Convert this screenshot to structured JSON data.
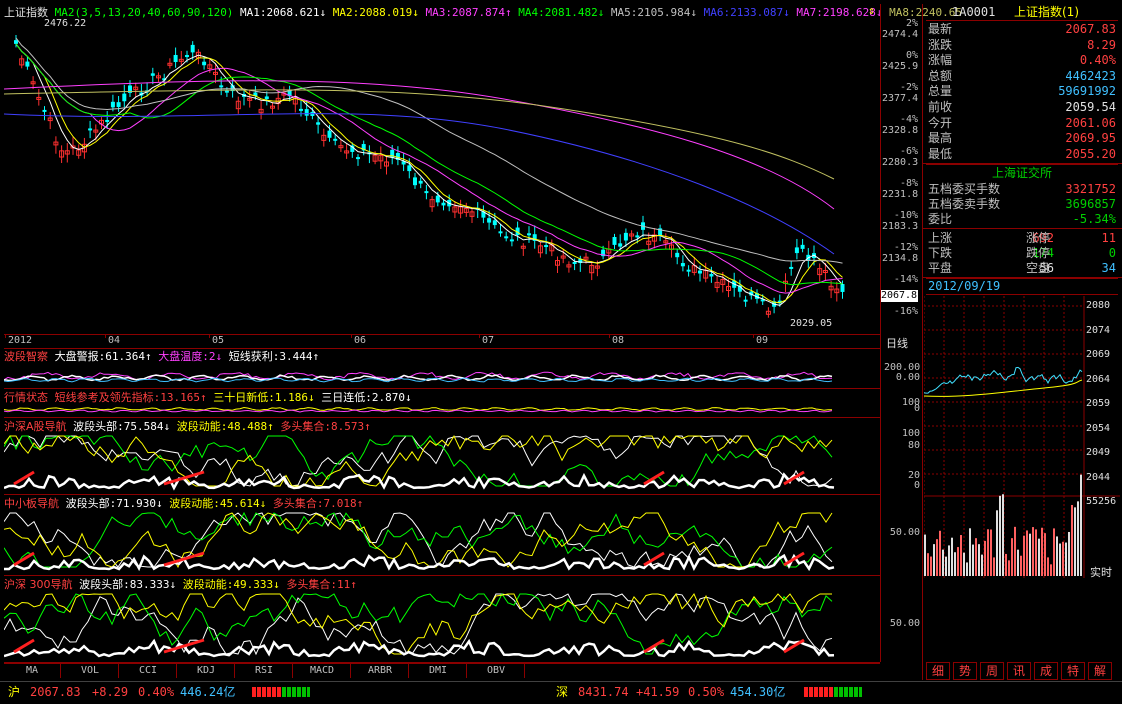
{
  "main": {
    "title": "上证指数",
    "ma_legend": [
      {
        "text": "MA2(3,5,13,20,40,60,90,120)",
        "color": "#00ff00"
      },
      {
        "text": "MA1:2068.621↓",
        "color": "#ffffff"
      },
      {
        "text": "MA2:2088.019↓",
        "color": "#ffff00"
      },
      {
        "text": "MA3:2087.874↑",
        "color": "#ff40ff"
      },
      {
        "text": "MA4:2081.482↓",
        "color": "#00ff00"
      },
      {
        "text": "MA5:2105.984↓",
        "color": "#c0c0c0"
      },
      {
        "text": "MA6:2133.087↓",
        "color": "#4040ff"
      },
      {
        "text": "MA7:2198.628↓",
        "color": "#ff40ff"
      },
      {
        "text": "MA8:2240.65",
        "color": "#c0c060"
      }
    ],
    "high_label": "2476.22",
    "low_label": "2029.05",
    "current_price_tag": "2067.8",
    "y_axis": [
      {
        "price": "2474.4",
        "pct": "2%"
      },
      {
        "price": "2425.9",
        "pct": "0%"
      },
      {
        "price": "2377.4",
        "pct": "-2%"
      },
      {
        "price": "2328.8",
        "pct": "-4%"
      },
      {
        "price": "2280.3",
        "pct": "-6%"
      },
      {
        "price": "2231.8",
        "pct": "-8%"
      },
      {
        "price": "2183.3",
        "pct": "-10%"
      },
      {
        "price": "2134.8",
        "pct": "-12%"
      },
      {
        "price": "",
        "pct": "-14%"
      },
      {
        "price": "",
        "pct": "-16%"
      }
    ],
    "x_axis": [
      "2012",
      "04",
      "05",
      "06",
      "07",
      "08",
      "09"
    ],
    "period": "日线"
  },
  "pane1": {
    "title": "波段智察",
    "items": [
      {
        "text": "大盘警报:61.364↑",
        "color": "#ffffff"
      },
      {
        "text": "大盘温度:2↓",
        "color": "#ff40ff"
      },
      {
        "text": "短线获利:3.444↑",
        "color": "#ffffff"
      }
    ],
    "axis": [
      "200.00",
      "0.00"
    ]
  },
  "pane2": {
    "title": "行情状态",
    "items": [
      {
        "text": "短线参考及领先指标:13.165↑",
        "color": "#ff4040"
      },
      {
        "text": "三十日新低:1.186↓",
        "color": "#ffff00"
      },
      {
        "text": "三日连低:2.870↓",
        "color": "#ffffff"
      }
    ],
    "axis": [
      "100",
      "0"
    ]
  },
  "pane3": {
    "title": "沪深A股导航",
    "items": [
      {
        "text": "波段头部:75.584↓",
        "color": "#ffffff"
      },
      {
        "text": "波段动能:48.488↑",
        "color": "#ffff00"
      },
      {
        "text": "多头集合:8.573↑",
        "color": "#ff4040"
      }
    ],
    "axis": [
      "100",
      "80",
      "20",
      "0"
    ]
  },
  "pane4": {
    "title": "中小板导航",
    "items": [
      {
        "text": "波段头部:71.930↓",
        "color": "#ffffff"
      },
      {
        "text": "波段动能:45.614↓",
        "color": "#ffff00"
      },
      {
        "text": "多头集合:7.018↑",
        "color": "#ff4040"
      }
    ],
    "axis": [
      "50.00"
    ]
  },
  "pane5": {
    "title": "沪深 300导航",
    "items": [
      {
        "text": "波段头部:83.333↓",
        "color": "#ffffff"
      },
      {
        "text": "波段动能:49.333↓",
        "color": "#ffff00"
      },
      {
        "text": "多头集合:11↑",
        "color": "#ff4040"
      }
    ],
    "axis": [
      "50.00"
    ]
  },
  "indicator_tabs": [
    "MA",
    "VOL",
    "CCI",
    "KDJ",
    "RSI",
    "MACD",
    "ARBR",
    "DMI",
    "OBV"
  ],
  "quote": {
    "code": "1A0001",
    "name": "上证指数(1)",
    "rows": [
      {
        "label": "最新",
        "value": "2067.83",
        "color": "#ff4040"
      },
      {
        "label": "涨跌",
        "value": "8.29",
        "color": "#ff4040"
      },
      {
        "label": "涨幅",
        "value": "0.40%",
        "color": "#ff4040"
      },
      {
        "label": "总额",
        "value": "4462423",
        "color": "#40c0ff"
      },
      {
        "label": "总量",
        "value": "59691992",
        "color": "#40c0ff"
      },
      {
        "label": "前收",
        "value": "2059.54",
        "color": "#e0e0e0"
      },
      {
        "label": "今开",
        "value": "2061.06",
        "color": "#ff4040"
      },
      {
        "label": "最高",
        "value": "2069.95",
        "color": "#ff4040"
      },
      {
        "label": "最低",
        "value": "2055.20",
        "color": "#ff4040"
      }
    ],
    "exchange": "上海证交所",
    "order_rows": [
      {
        "label": "五档委买手数",
        "value": "3321752",
        "color": "#ff4040"
      },
      {
        "label": "五档委卖手数",
        "value": "3696857",
        "color": "#00d000"
      },
      {
        "label": "委比",
        "value": "-5.34%",
        "color": "#00d000"
      }
    ],
    "breadth": [
      {
        "l1": "上涨",
        "v1": "692",
        "c1": "#ff4040",
        "l2": "涨停",
        "v2": "11",
        "c2": "#ff4040"
      },
      {
        "l1": "下跌",
        "v1": "174",
        "c1": "#00d000",
        "l2": "跌停",
        "v2": "0",
        "c2": "#00d000"
      },
      {
        "l1": "平盘",
        "v1": "56",
        "c1": "#e0e0e0",
        "l2": "空盘",
        "v2": "34",
        "c2": "#40c0ff"
      }
    ],
    "date": "2012/09/19"
  },
  "intraday": {
    "y_axis": [
      "2080",
      "2074",
      "2069",
      "2064",
      "2059",
      "2054",
      "2049",
      "2044"
    ],
    "vol_max": "55256",
    "realtime_label": "实时"
  },
  "right_tabs": [
    "细",
    "势",
    "周",
    "讯",
    "成",
    "特",
    "解"
  ],
  "status": {
    "sh_label": "沪",
    "sh_price": "2067.83",
    "sh_change": "+8.29",
    "sh_pct": "0.40%",
    "sh_amount": "446.24亿",
    "sz_label": "深",
    "sz_price": "8431.74",
    "sz_change": "+41.59",
    "sz_pct": "0.50%",
    "sz_amount": "454.30亿"
  }
}
